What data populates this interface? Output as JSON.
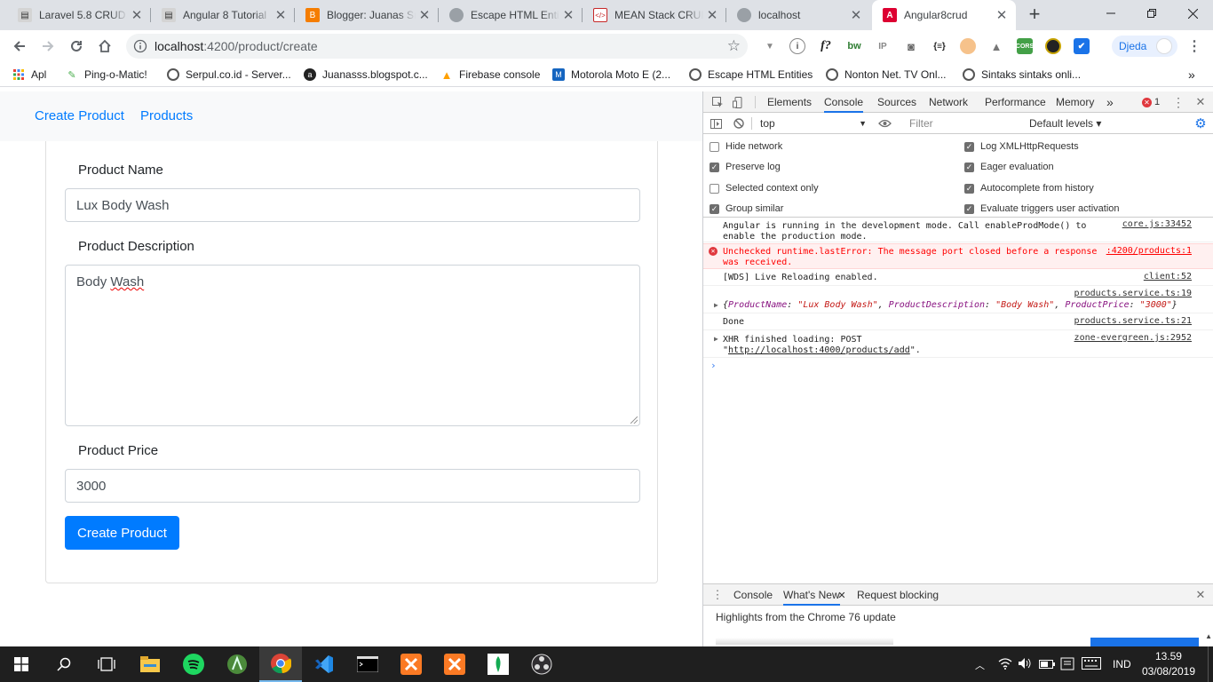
{
  "browser": {
    "tabs": [
      {
        "title": "Laravel 5.8 CRUD T",
        "icon": "laravel-favicon"
      },
      {
        "title": "Angular 8 Tutorial",
        "icon": "tutorial-favicon"
      },
      {
        "title": "Blogger: Juanas Sr",
        "icon": "blogger-favicon"
      },
      {
        "title": "Escape HTML Enti",
        "icon": "globe-favicon"
      },
      {
        "title": "MEAN Stack CRUD",
        "icon": "code-favicon"
      },
      {
        "title": "localhost",
        "icon": "globe-favicon"
      },
      {
        "title": "Angular8crud",
        "icon": "angular-favicon",
        "active": true
      }
    ],
    "new_tab": "+",
    "url_host": "localhost",
    "url_path": ":4200/product/create",
    "profile_name": "Djeda",
    "bookmarks": [
      {
        "label": "Apl",
        "icon": "apps-icon"
      },
      {
        "label": "Ping-o-Matic!",
        "icon": "ping-icon"
      },
      {
        "label": "Serpul.co.id - Server...",
        "icon": "globe-icon"
      },
      {
        "label": "Juanasss.blogspot.c...",
        "icon": "blog-icon"
      },
      {
        "label": "Firebase console",
        "icon": "firebase-icon"
      },
      {
        "label": "Motorola Moto E (2...",
        "icon": "moto-icon"
      },
      {
        "label": "Escape HTML Entities",
        "icon": "globe-icon"
      },
      {
        "label": "Nonton Net. TV Onl...",
        "icon": "globe-icon"
      },
      {
        "label": "Sintaks sintaks onli...",
        "icon": "globe-icon"
      }
    ],
    "bookmarks_more": "»"
  },
  "app": {
    "nav": {
      "create_product": "Create Product",
      "products": "Products"
    },
    "form": {
      "name_label": "Product Name",
      "name_value": "Lux Body Wash",
      "description_label": "Product Description",
      "description_value_first": "Body",
      "description_value_second": "Wash",
      "price_label": "Product Price",
      "price_value": "3000",
      "submit_label": "Create Product"
    }
  },
  "devtools": {
    "tabs": [
      "Elements",
      "Console",
      "Sources",
      "Network",
      "Performance",
      "Memory"
    ],
    "more_tabs": "»",
    "error_count": "1",
    "context": "top",
    "filter_placeholder": "Filter",
    "levels": "Default levels ▾",
    "settings": {
      "hide_network": "Hide network",
      "preserve_log": "Preserve log",
      "selected_context_only": "Selected context only",
      "group_similar": "Group similar",
      "log_xhr": "Log XMLHttpRequests",
      "eager_evaluation": "Eager evaluation",
      "autocomplete_history": "Autocomplete from history",
      "evaluate_triggers": "Evaluate triggers user activation"
    },
    "messages": {
      "m1_line1": "Angular is running in the development mode. Call enableProdMode() to",
      "m1_line2": "enable the production mode.",
      "m1_src": "core.js:33452",
      "m2_line1": "Unchecked runtime.lastError: The message port closed before a response",
      "m2_line2": "was received.",
      "m2_src": ":4200/products:1",
      "m3_text": "[WDS] Live Reloading enabled.",
      "m3_src": "client:52",
      "m4_src": "products.service.ts:19",
      "m4_obj": {
        "open": "{",
        "k1": "ProductName",
        "v1": "\"Lux Body Wash\"",
        "k2": "ProductDescription",
        "v2": "\"Body Wash\"",
        "k3": "ProductPrice",
        "v3": "\"3000\"",
        "close": "}"
      },
      "m5_text": "Done",
      "m5_src": "products.service.ts:21",
      "m6_line1": "XHR finished loading: POST",
      "m6_line2_q1": "\"",
      "m6_link": "http://localhost:4000/products/add",
      "m6_line2_q2": "\".",
      "m6_src": "zone-evergreen.js:2952"
    },
    "drawer": {
      "tabs": [
        "Console",
        "What's New",
        "Request blocking"
      ],
      "body": "Highlights from the Chrome 76 update"
    }
  },
  "taskbar": {
    "language": "IND",
    "time": "13.59",
    "date": "03/08/2019"
  }
}
